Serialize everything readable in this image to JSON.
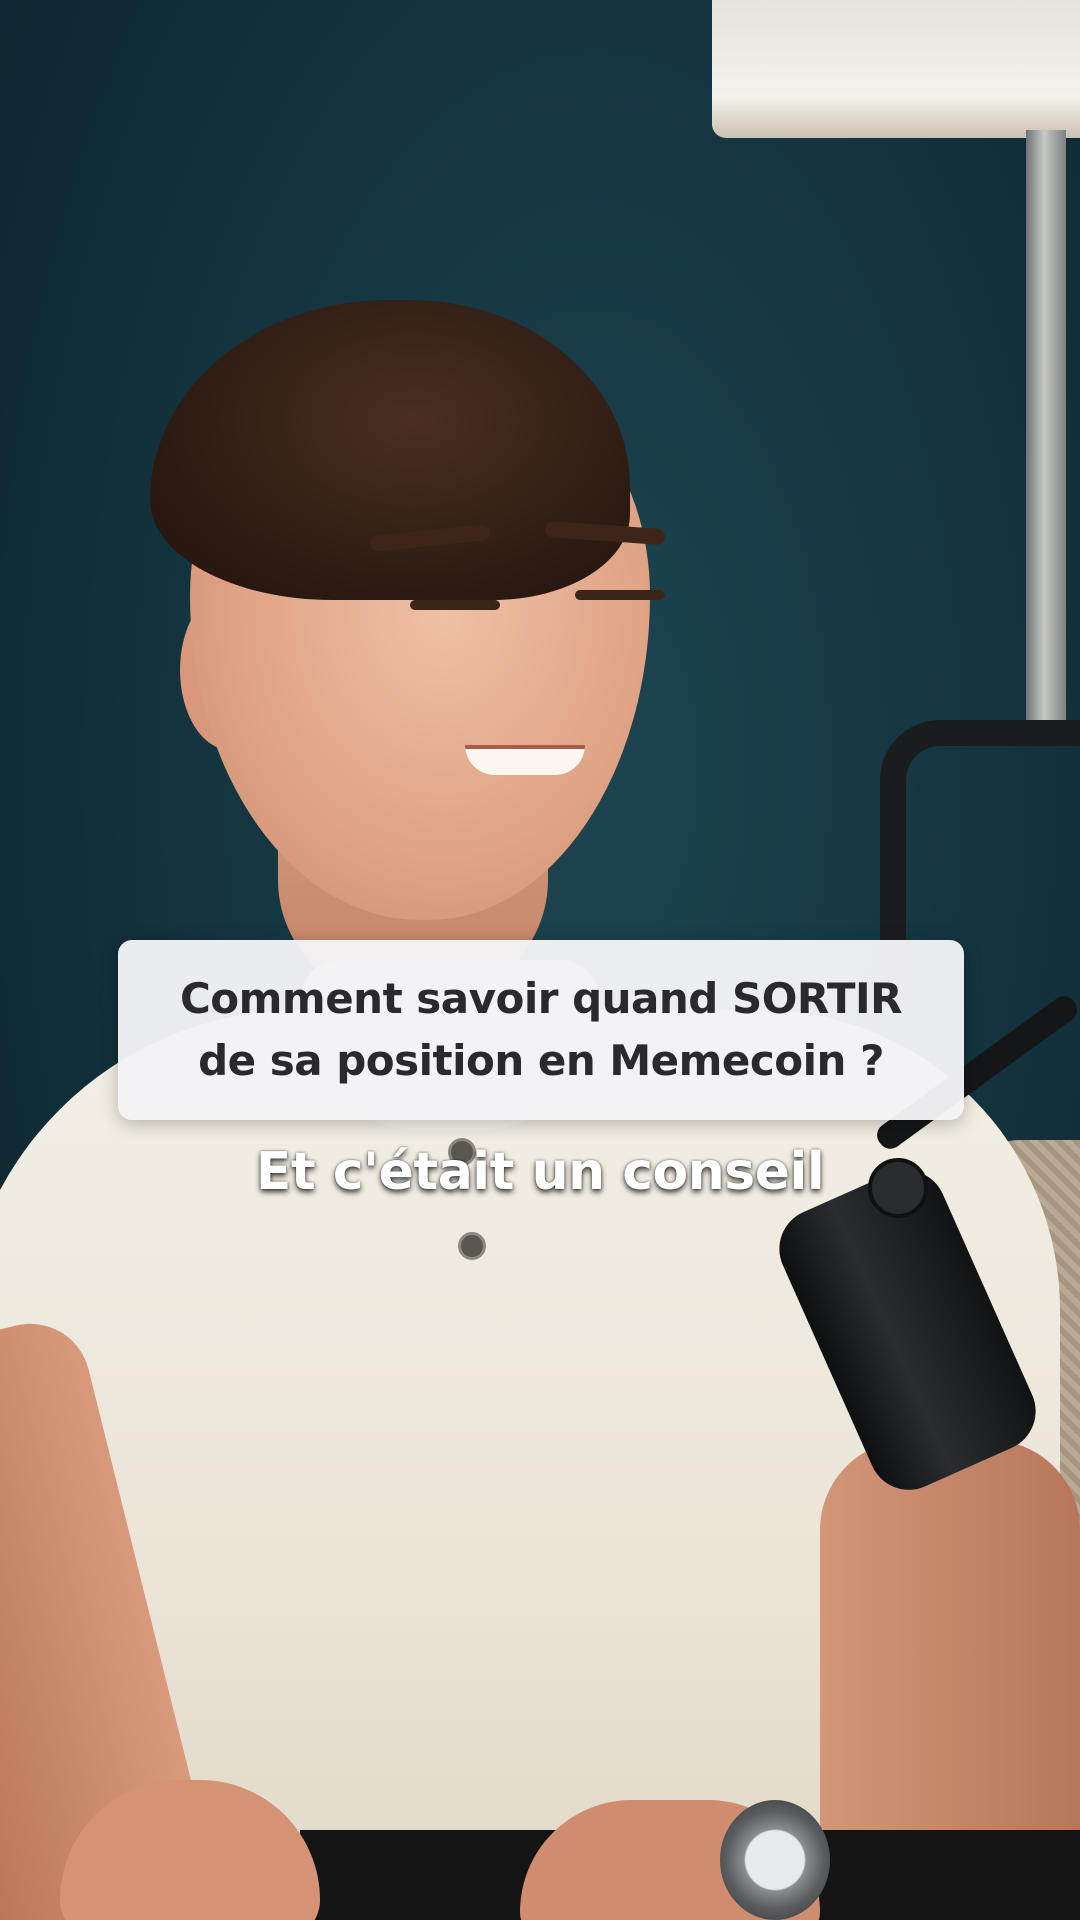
{
  "title_card": {
    "line1": "Comment savoir quand SORTIR",
    "line2": "de sa position en Memecoin ?"
  },
  "caption": {
    "text": "Et c'était un conseil"
  }
}
